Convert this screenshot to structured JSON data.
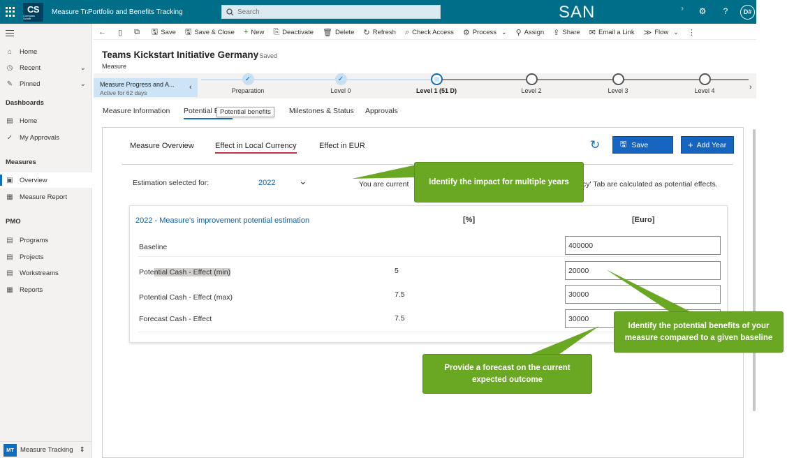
{
  "topbar": {
    "logo_main": "CS",
    "logo_sub": "Compass Schott",
    "app_name": "Measure Tra",
    "app_title": "Portfolio and Benefits Tracking",
    "search_placeholder": "Search",
    "env_label": "SAN",
    "help_glyph": "?",
    "avatar": "D#"
  },
  "nav": {
    "items_top": [
      {
        "label": "Home",
        "icon": "home-icon"
      },
      {
        "label": "Recent",
        "icon": "clock-icon"
      },
      {
        "label": "Pinned",
        "icon": "pin-icon"
      }
    ],
    "dashboards_header": "Dashboards",
    "dashboards": [
      {
        "label": "Home"
      },
      {
        "label": "My Approvals"
      }
    ],
    "measures_header": "Measures",
    "measures": [
      {
        "label": "Overview"
      },
      {
        "label": "Measure Report"
      }
    ],
    "pmo_header": "PMO",
    "pmo": [
      {
        "label": "Programs"
      },
      {
        "label": "Projects"
      },
      {
        "label": "Workstreams"
      },
      {
        "label": "Reports"
      }
    ],
    "area_badge": "MT",
    "area_label": "Measure Tracking"
  },
  "commands": {
    "save": "Save",
    "save_close": "Save & Close",
    "new": "New",
    "deactivate": "Deactivate",
    "delete": "Delete",
    "refresh": "Refresh",
    "check_access": "Check Access",
    "process": "Process",
    "assign": "Assign",
    "share": "Share",
    "email_link": "Email a Link",
    "flow": "Flow"
  },
  "record": {
    "title": "Teams Kickstart Initiative Germany",
    "saved": "- Saved",
    "entity": "Measure"
  },
  "bpf": {
    "active_stage": "Measure Progress and A...",
    "active_for": "Active for 62 days",
    "stages": [
      {
        "label": "Preparation"
      },
      {
        "label": "Level 0"
      },
      {
        "label": "Level 1  (51 D)"
      },
      {
        "label": "Level 2"
      },
      {
        "label": "Level 3"
      },
      {
        "label": "Level 4"
      }
    ]
  },
  "form_tabs": {
    "measure_information": "Measure Information",
    "potential_benefits_visible": "Potential B",
    "tooltip": "Potential benefits",
    "milestones": "Milestones & Status",
    "approvals": "Approvals"
  },
  "panel": {
    "tabs": [
      "Measure Overview",
      "Effect in Local Currency",
      "Effect in EUR"
    ],
    "save_btn": "Save",
    "add_year_btn": "Add Year",
    "estimation_label": "Estimation selected for:",
    "estimation_year": "2022",
    "notice_start": "You are current",
    "notice_end": "cy' Tab are calculated as potential effects.",
    "card_title": "2022 - Measure's improvement potential estimation",
    "col_pct": "[%]",
    "col_euro": "[Euro]",
    "rows": [
      {
        "label": "Baseline",
        "pct": "",
        "value": "400000"
      },
      {
        "label_a": "Pote",
        "label_b": "ntial Cash - Effect (min)",
        "pct": "5",
        "value": "20000"
      },
      {
        "label": "Potential Cash - Effect (max)",
        "pct": "7.5",
        "value": "30000"
      },
      {
        "label": "Forecast Cash - Effect",
        "pct": "7.5",
        "value": "30000"
      }
    ]
  },
  "callouts": {
    "multi_years": "Identify the impact for multiple years",
    "potential_benefits": "Identify the potential benefits of your measure compared to a given baseline",
    "forecast": "Provide a forecast on the current expected outcome"
  },
  "colors": {
    "topbar": "#006d89",
    "accent": "#0f6cbd",
    "callout_green": "#6aa824",
    "tab_underline": "#c4314b"
  }
}
